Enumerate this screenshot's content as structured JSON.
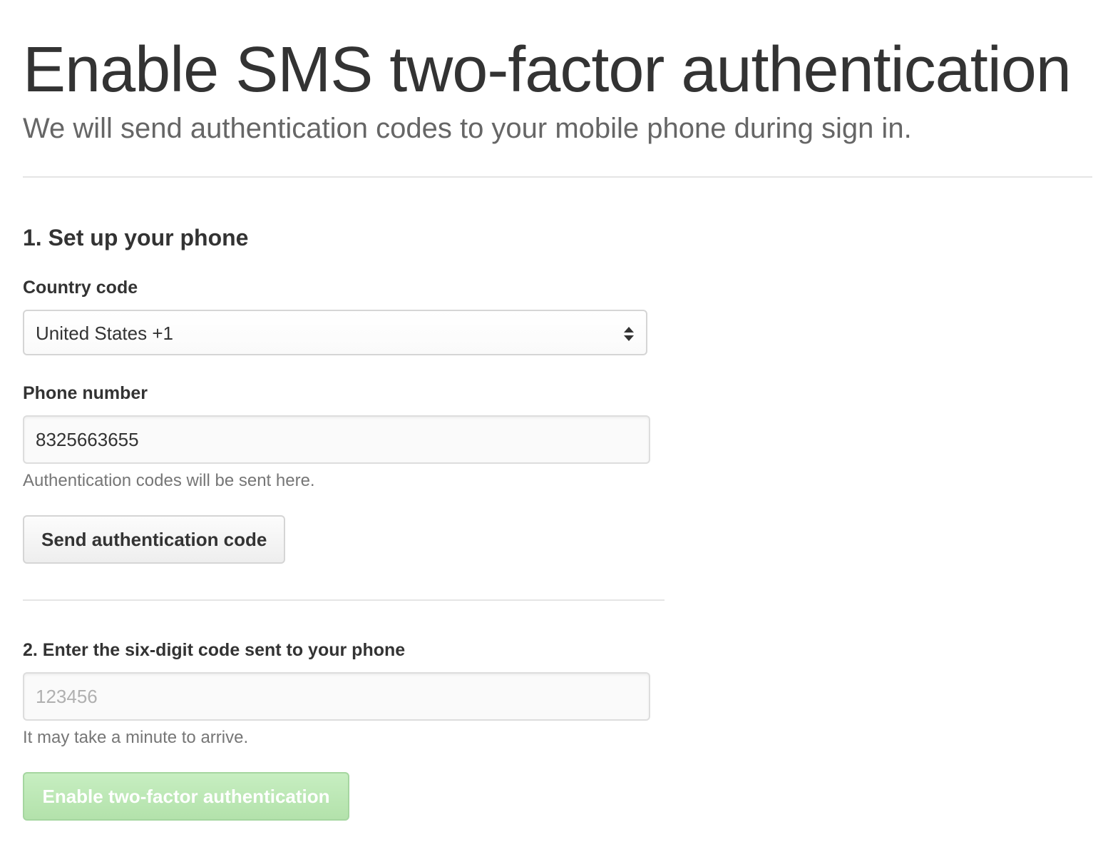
{
  "header": {
    "title": "Enable SMS two-factor authentication",
    "subtitle": "We will send authentication codes to your mobile phone during sign in."
  },
  "step1": {
    "heading": "1. Set up your phone",
    "country_code": {
      "label": "Country code",
      "selected_value": "United States +1",
      "icon": "select-arrows-icon"
    },
    "phone_number": {
      "label": "Phone number",
      "value": "8325663655",
      "help_text": "Authentication codes will be sent here."
    },
    "send_button_label": "Send authentication code"
  },
  "step2": {
    "heading": "2. Enter the six-digit code sent to your phone",
    "code_input": {
      "value": "",
      "placeholder": "123456",
      "help_text": "It may take a minute to arrive."
    },
    "enable_button_label": "Enable two-factor authentication",
    "enable_button_disabled": true
  },
  "colors": {
    "text": "#333333",
    "muted_text": "#767676",
    "border": "#d5d5d5",
    "divider": "#e5e5e5",
    "enable_button_bg": "#bde8b6",
    "enable_button_border": "#a5d6a0"
  }
}
